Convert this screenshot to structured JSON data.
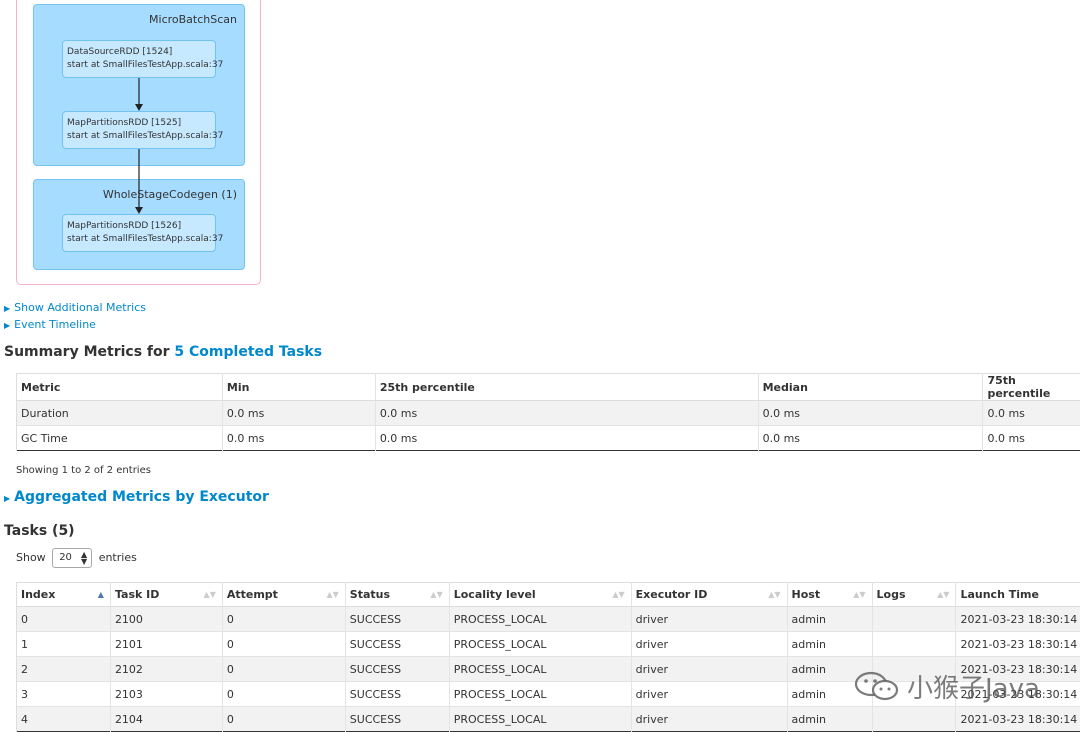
{
  "dag": {
    "clusters": [
      {
        "label": "MicroBatchScan"
      },
      {
        "label": "WholeStageCodegen (1)"
      }
    ],
    "nodes": [
      {
        "name": "DataSourceRDD [1524]",
        "detail": "start at SmallFilesTestApp.scala:37"
      },
      {
        "name": "MapPartitionsRDD [1525]",
        "detail": "start at SmallFilesTestApp.scala:37"
      },
      {
        "name": "MapPartitionsRDD [1526]",
        "detail": "start at SmallFilesTestApp.scala:37"
      }
    ]
  },
  "expanders": {
    "additional_metrics": "Show Additional Metrics",
    "event_timeline": "Event Timeline",
    "aggregated": "Aggregated Metrics by Executor"
  },
  "summary": {
    "title_prefix": "Summary Metrics for ",
    "title_link": "5 Completed Tasks",
    "columns": [
      "Metric",
      "Min",
      "25th percentile",
      "Median",
      "75th percentile"
    ],
    "rows": [
      [
        "Duration",
        "0.0 ms",
        "0.0 ms",
        "0.0 ms",
        "0.0 ms"
      ],
      [
        "GC Time",
        "0.0 ms",
        "0.0 ms",
        "0.0 ms",
        "0.0 ms"
      ]
    ],
    "info": "Showing 1 to 2 of 2 entries"
  },
  "tasks": {
    "title": "Tasks (5)",
    "show_label": "Show",
    "show_value": "20",
    "entries_label": "entries",
    "columns": [
      "Index",
      "Task ID",
      "Attempt",
      "Status",
      "Locality level",
      "Executor ID",
      "Host",
      "Logs",
      "Launch Time"
    ],
    "rows": [
      [
        "0",
        "2100",
        "0",
        "SUCCESS",
        "PROCESS_LOCAL",
        "driver",
        "admin",
        "",
        "2021-03-23 18:30:14"
      ],
      [
        "1",
        "2101",
        "0",
        "SUCCESS",
        "PROCESS_LOCAL",
        "driver",
        "admin",
        "",
        "2021-03-23 18:30:14"
      ],
      [
        "2",
        "2102",
        "0",
        "SUCCESS",
        "PROCESS_LOCAL",
        "driver",
        "admin",
        "",
        "2021-03-23 18:30:14"
      ],
      [
        "3",
        "2103",
        "0",
        "SUCCESS",
        "PROCESS_LOCAL",
        "driver",
        "admin",
        "",
        "2021-03-23 18:30:14"
      ],
      [
        "4",
        "2104",
        "0",
        "SUCCESS",
        "PROCESS_LOCAL",
        "driver",
        "admin",
        "",
        "2021-03-23 18:30:14"
      ]
    ]
  },
  "watermark": {
    "text": "小猴子Java"
  },
  "colors": {
    "link": "#0088cc",
    "cluster": "#a6dcff",
    "node": "#c6e9ff",
    "stripe": "#f2f2f2"
  }
}
